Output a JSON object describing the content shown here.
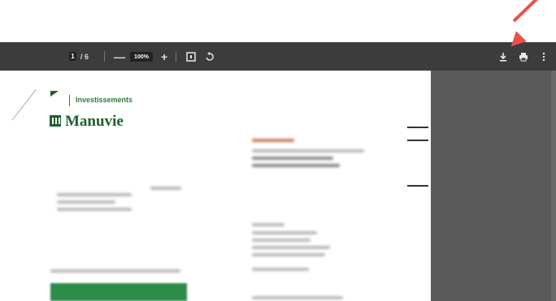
{
  "toolbar": {
    "page_current": "1",
    "page_total": "/ 6",
    "zoom_out": "—",
    "zoom_level": "100%",
    "zoom_in": "+",
    "fit_icon": "fit-page-icon",
    "rotate_icon": "rotate-icon",
    "download_icon": "download-icon",
    "print_icon": "print-icon",
    "more_icon": "more-vert-icon"
  },
  "document": {
    "logo_top": "Investissements",
    "logo_main": "Manuvie"
  },
  "colors": {
    "toolbar_bg": "#3c3c3c",
    "side_panel_bg": "#5a5a5a",
    "brand_green": "#1f5f2c",
    "arrow": "#e8504a"
  }
}
